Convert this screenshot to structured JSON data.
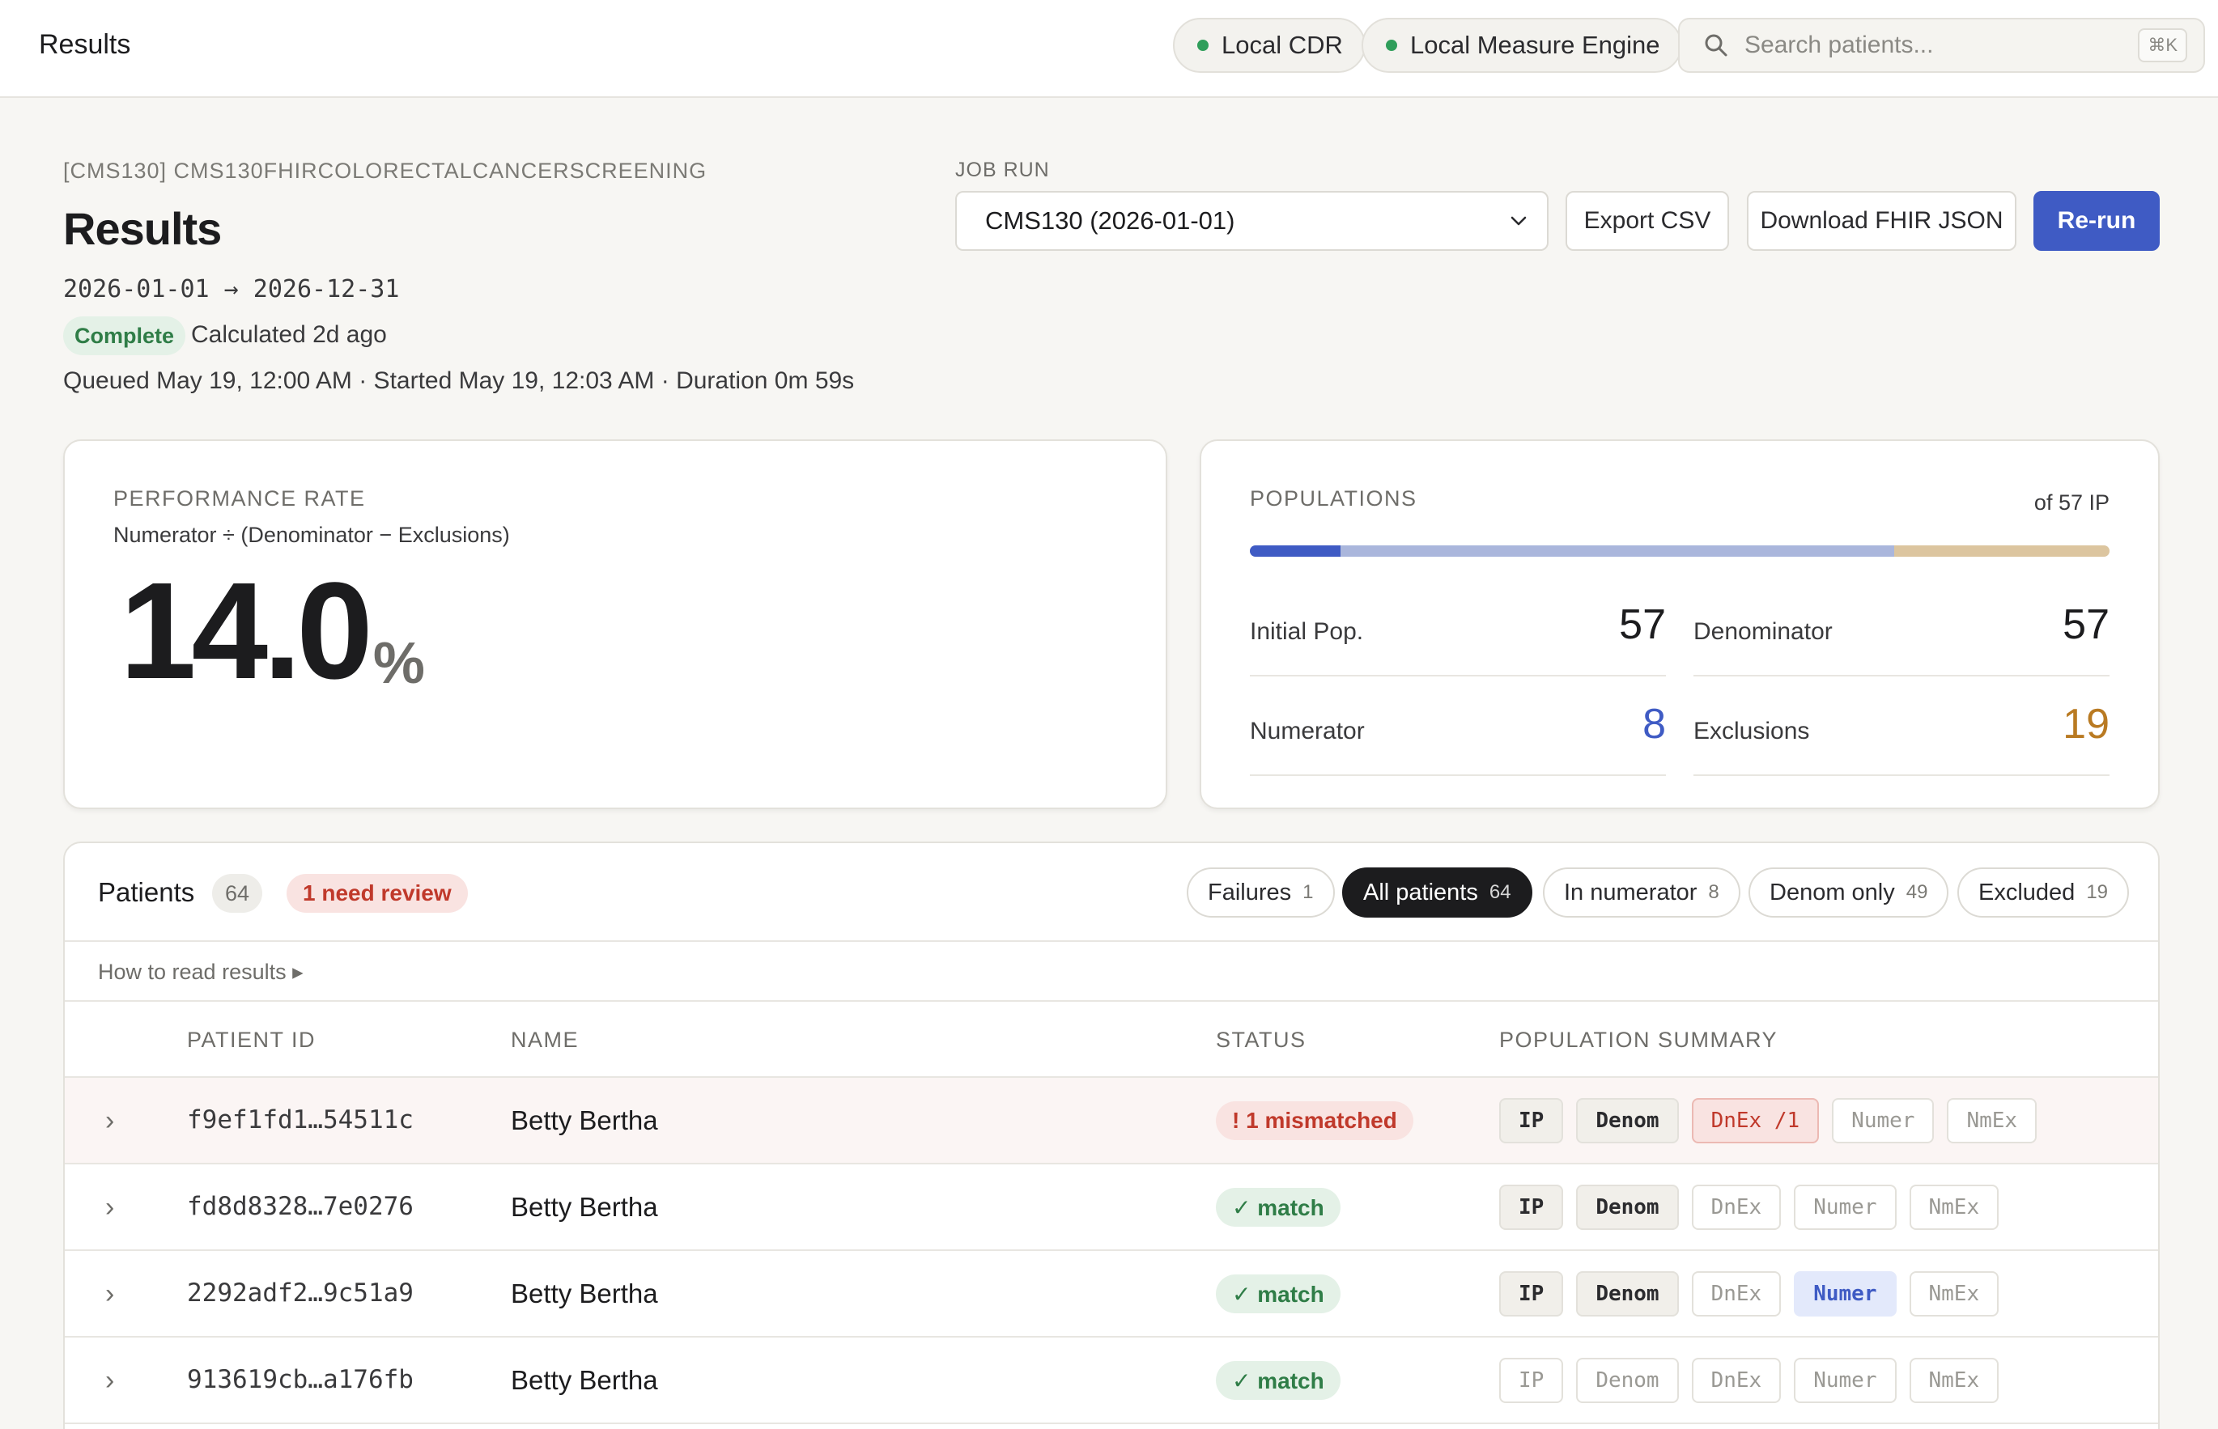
{
  "topbar": {
    "title": "Results",
    "connections": [
      "Local CDR",
      "Local Measure Engine"
    ],
    "search_placeholder": "Search patients...",
    "search_shortcut": "⌘K"
  },
  "header": {
    "breadcrumb": "[CMS130] CMS130FHIRCOLORECTALCANCERSCREENING",
    "title": "Results",
    "period": "2026-01-01 → 2026-12-31",
    "status_badge": "Complete",
    "calculated": "Calculated 2d ago",
    "meta": "Queued May 19, 12:00 AM · Started May 19, 12:03 AM · Duration 0m 59s"
  },
  "jobrun": {
    "label": "JOB RUN",
    "selected": "CMS130 (2026-01-01)",
    "export_csv": "Export CSV",
    "download_fhir": "Download FHIR JSON",
    "rerun": "Re-run"
  },
  "performance": {
    "label": "PERFORMANCE RATE",
    "formula": "Numerator ÷ (Denominator − Exclusions)",
    "value": "14.0",
    "unit": "%"
  },
  "populations": {
    "label": "POPULATIONS",
    "of_label": "of 57 IP",
    "bar_segments": [
      {
        "fraction": 0.105,
        "color": "#3f5bc4"
      },
      {
        "fraction": 0.645,
        "color": "#aab6dc"
      },
      {
        "fraction": 0.25,
        "color": "#dcc59f"
      }
    ],
    "stats": [
      {
        "label": "Initial Pop.",
        "value": "57",
        "color": "#1c1c1e"
      },
      {
        "label": "Denominator",
        "value": "57",
        "color": "#1c1c1e"
      },
      {
        "label": "Numerator",
        "value": "8",
        "color": "#3f5bc4"
      },
      {
        "label": "Exclusions",
        "value": "19",
        "color": "#b97a22"
      }
    ]
  },
  "patients": {
    "title": "Patients",
    "count": "64",
    "review": "1 need review",
    "filters": [
      {
        "label": "Failures",
        "count": "1",
        "active": false
      },
      {
        "label": "All patients",
        "count": "64",
        "active": true
      },
      {
        "label": "In numerator",
        "count": "8",
        "active": false
      },
      {
        "label": "Denom only",
        "count": "49",
        "active": false
      },
      {
        "label": "Excluded",
        "count": "19",
        "active": false
      }
    ],
    "howto": "How to read results ▸",
    "columns": [
      "PATIENT ID",
      "NAME",
      "STATUS",
      "POPULATION SUMMARY"
    ],
    "rows": [
      {
        "id": "f9ef1fd1…54511c",
        "name": "Betty Bertha",
        "status": "! 1 mismatched",
        "status_kind": "bad",
        "chips": [
          {
            "t": "IP",
            "k": "on"
          },
          {
            "t": "Denom",
            "k": "on"
          },
          {
            "t": "DnEx /1",
            "k": "err"
          },
          {
            "t": "Numer",
            "k": "off"
          },
          {
            "t": "NmEx",
            "k": "off"
          }
        ]
      },
      {
        "id": "fd8d8328…7e0276",
        "name": "Betty Bertha",
        "status": "✓ match",
        "status_kind": "ok",
        "chips": [
          {
            "t": "IP",
            "k": "on"
          },
          {
            "t": "Denom",
            "k": "on"
          },
          {
            "t": "DnEx",
            "k": "off"
          },
          {
            "t": "Numer",
            "k": "off"
          },
          {
            "t": "NmEx",
            "k": "off"
          }
        ]
      },
      {
        "id": "2292adf2…9c51a9",
        "name": "Betty Bertha",
        "status": "✓ match",
        "status_kind": "ok",
        "chips": [
          {
            "t": "IP",
            "k": "on"
          },
          {
            "t": "Denom",
            "k": "on"
          },
          {
            "t": "DnEx",
            "k": "off"
          },
          {
            "t": "Numer",
            "k": "blue"
          },
          {
            "t": "NmEx",
            "k": "off"
          }
        ]
      },
      {
        "id": "913619cb…a176fb",
        "name": "Betty Bertha",
        "status": "✓ match",
        "status_kind": "ok",
        "chips": [
          {
            "t": "IP",
            "k": "off"
          },
          {
            "t": "Denom",
            "k": "off"
          },
          {
            "t": "DnEx",
            "k": "off"
          },
          {
            "t": "Numer",
            "k": "off"
          },
          {
            "t": "NmEx",
            "k": "off"
          }
        ]
      }
    ]
  }
}
